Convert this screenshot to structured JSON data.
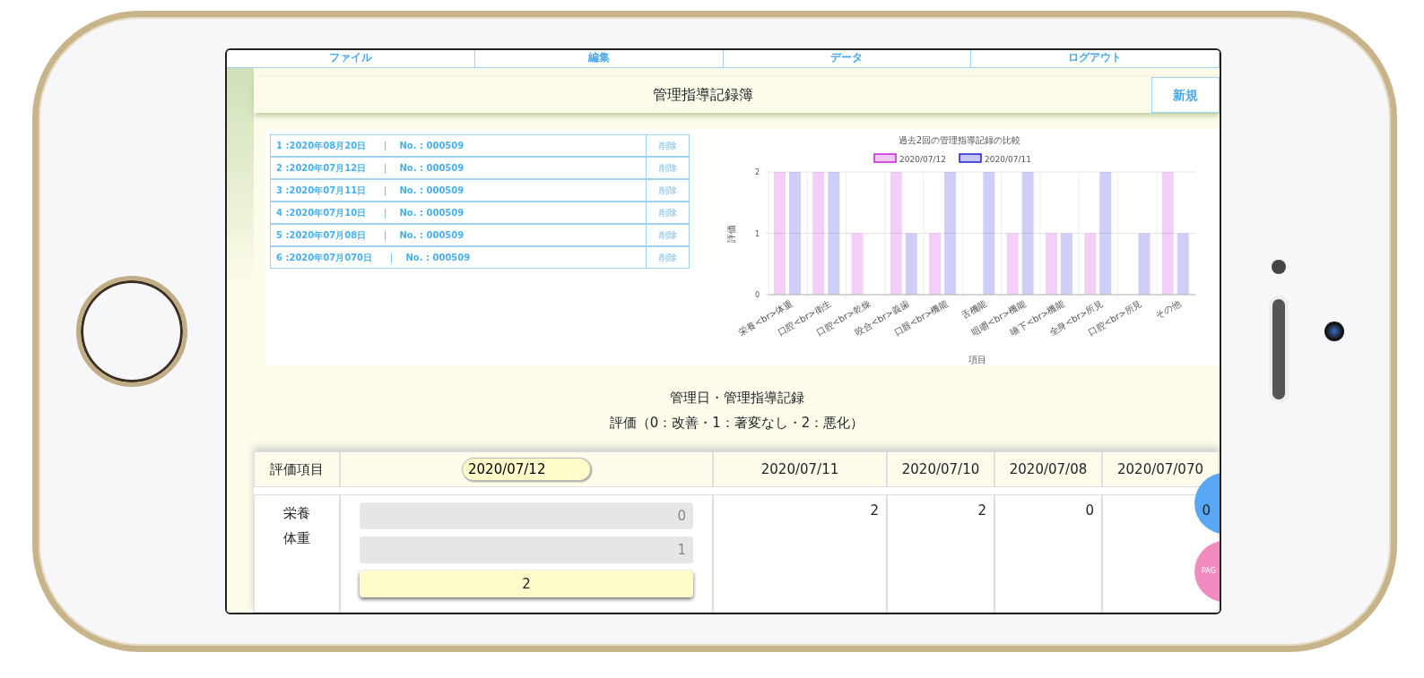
{
  "menu": [
    {
      "label": "ファイル"
    },
    {
      "label": "編集"
    },
    {
      "label": "データ"
    },
    {
      "label": "ログアウト"
    }
  ],
  "title": "管理指導記録簿",
  "new_button": "新規",
  "records": [
    {
      "label": "1 :2020年08月20日",
      "separator": "|",
      "number": "No. : 000509",
      "delete": "削除"
    },
    {
      "label": "2 :2020年07月12日",
      "separator": "|",
      "number": "No. : 000509",
      "delete": "削除"
    },
    {
      "label": "3 :2020年07月11日",
      "separator": "|",
      "number": "No. : 000509",
      "delete": "削除"
    },
    {
      "label": "4 :2020年07月10日",
      "separator": "|",
      "number": "No. : 000509",
      "delete": "削除"
    },
    {
      "label": "5 :2020年07月08日",
      "separator": "|",
      "number": "No. : 000509",
      "delete": "削除"
    },
    {
      "label": "6 :2020年07月070日",
      "separator": "|",
      "number": "No. : 000509",
      "delete": "削除"
    }
  ],
  "chart_data": {
    "type": "bar",
    "title": "過去2回の管理指導記録の比較",
    "xlabel": "項目",
    "ylabel": "評価",
    "categories": [
      "栄養<br>体重",
      "口腔<br>衛生",
      "口腔<br>乾燥",
      "咬合<br>義歯",
      "口唇<br>機能",
      "舌機能",
      "咀嚼<br>機能",
      "嚥下<br>機能",
      "全身<br>所見",
      "口腔<br>所見",
      "その他"
    ],
    "series": [
      {
        "name": "2020/07/12",
        "color": "#c71fd6",
        "values": [
          2,
          2,
          1,
          2,
          1,
          0,
          1,
          1,
          1,
          0,
          2
        ]
      },
      {
        "name": "2020/07/11",
        "color": "#1f1fd6",
        "values": [
          2,
          2,
          0,
          1,
          2,
          2,
          2,
          1,
          2,
          1,
          1
        ]
      }
    ],
    "ylim": [
      0,
      2
    ],
    "yticks": [
      0,
      1,
      2
    ],
    "legend": true,
    "grid": true
  },
  "section_title": "管理日・管理指導記録",
  "legend_text": "評価（0：改善・1：著変なし・2：悪化）",
  "table": {
    "item_header": "評価項目",
    "date_input": "2020/07/12",
    "columns": [
      "2020/07/11",
      "2020/07/10",
      "2020/07/08",
      "2020/07/070"
    ],
    "rows": [
      {
        "label_lines": [
          "栄養",
          "体重"
        ],
        "options": [
          {
            "label": "0",
            "selected": false
          },
          {
            "label": "1",
            "selected": false
          },
          {
            "label": "2",
            "selected": true
          }
        ],
        "values": [
          "2",
          "2",
          "0",
          "0"
        ]
      }
    ]
  },
  "floating_buttons": [
    {
      "color": "#5aa8f5"
    },
    {
      "color": "#f28cc0",
      "label": "PAG"
    }
  ]
}
